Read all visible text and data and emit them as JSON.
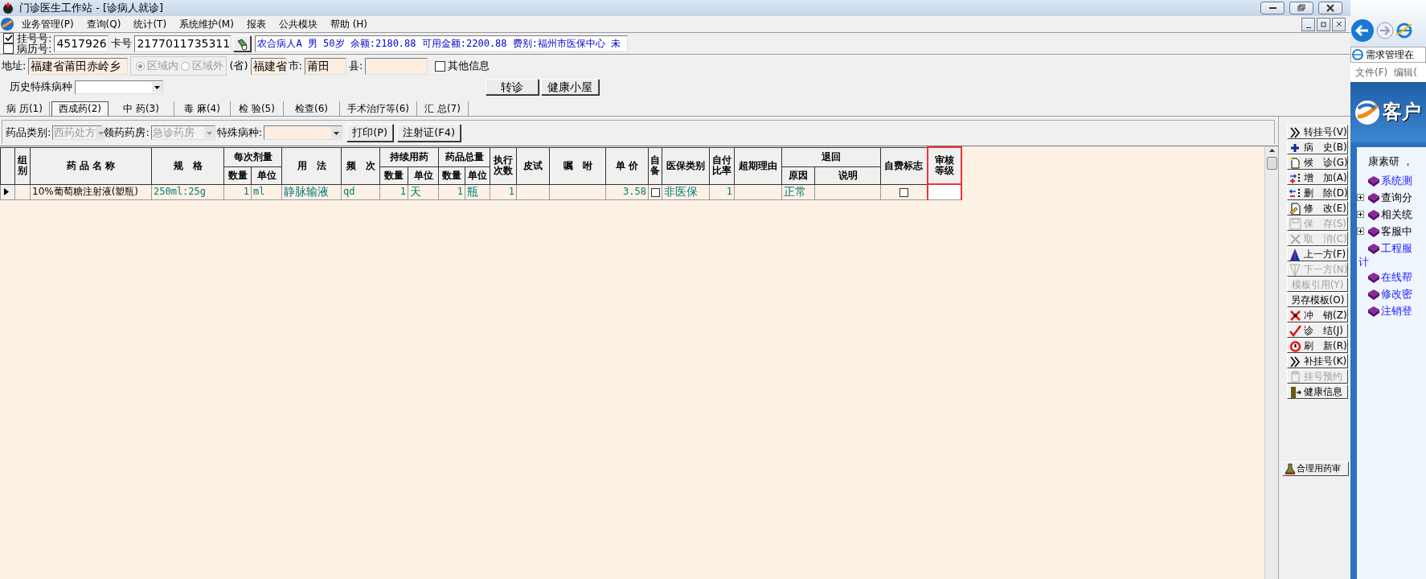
{
  "window": {
    "title": "门诊医生工作站 - [诊病人就诊]"
  },
  "menu": [
    "业务管理(P)",
    "查询(Q)",
    "统计(T)",
    "系统维护(M)",
    "报表",
    "公共模块",
    "帮助 (H)"
  ],
  "patient": {
    "id_options": [
      {
        "label": "挂号号:",
        "checked": true
      },
      {
        "label": "病历号:",
        "checked": false
      }
    ],
    "id_value": "4517926",
    "card_label": "卡号",
    "card_value": "2177011735311",
    "info": "农合病人A 男 50岁 余额:2180.88 可用金额:2200.88 费别:福州市医保中心 未"
  },
  "address": {
    "label": "地址:",
    "value": "福建省莆田赤岭乡",
    "regions": [
      {
        "label": "区域内",
        "selected": true,
        "disabled": true
      },
      {
        "label": "区域外",
        "selected": false,
        "disabled": true
      }
    ],
    "province_label": "(省)",
    "province": "福建省",
    "city_label": "市:",
    "city": "莆田",
    "county_label": "县:",
    "other_info": {
      "label": "其他信息",
      "checked": false
    }
  },
  "history": {
    "label": "历史特殊病种",
    "buttons": [
      "转诊",
      "健康小屋"
    ]
  },
  "tabs": [
    {
      "label": "病 历(1)",
      "selected": false
    },
    {
      "label": "西成药(2)",
      "selected": true
    },
    {
      "label": "中 药(3)",
      "selected": false
    },
    {
      "label": "毒 麻(4)",
      "selected": false
    },
    {
      "label": "检 验(5)",
      "selected": false
    },
    {
      "label": "检查(6)",
      "selected": false
    },
    {
      "label": "手术治疗等(6)",
      "selected": false
    },
    {
      "label": "汇 总(7)",
      "selected": false
    }
  ],
  "filters": [
    {
      "label": "药品类别:",
      "value": "西药处方",
      "disabled": true
    },
    {
      "label": "领药药房:",
      "value": "急诊药房",
      "disabled": true
    },
    {
      "label": "特殊病种:",
      "disabled": false
    }
  ],
  "filter_buttons": [
    "打印(P)",
    "注射证(F4)"
  ],
  "table": {
    "columns": [
      {
        "label": "组别",
        "highlighted": false
      },
      {
        "label": "药 品 名 称",
        "highlighted": false
      },
      {
        "label": "规　格",
        "highlighted": false
      },
      {
        "label": "每次剂量",
        "highlighted": false,
        "colspan": 2,
        "children": [
          "数量",
          "单位"
        ]
      },
      {
        "label": "用　法",
        "highlighted": false
      },
      {
        "label": "频　次",
        "highlighted": false
      },
      {
        "label": "持续用药",
        "highlighted": false,
        "colspan": 2,
        "children": [
          "数量",
          "单位"
        ]
      },
      {
        "label": "药品总量",
        "highlighted": false,
        "colspan": 2,
        "children": [
          "数量",
          "单位"
        ]
      },
      {
        "label": "执行次数",
        "highlighted": false
      },
      {
        "label": "皮试",
        "highlighted": false
      },
      {
        "label": "嘱　咐",
        "highlighted": false
      },
      {
        "label": "单 价",
        "highlighted": false
      },
      {
        "label": "自备",
        "highlighted": false
      },
      {
        "label": "医保类别",
        "highlighted": false
      },
      {
        "label": "自付比率",
        "highlighted": false
      },
      {
        "label": "超期理由",
        "highlighted": false
      },
      {
        "label": "退回",
        "highlighted": false,
        "colspan": 2,
        "children": [
          "原因",
          "说明"
        ]
      },
      {
        "label": "自费标志",
        "highlighted": false
      },
      {
        "label": "审核等级",
        "highlighted": true
      }
    ],
    "rows": [
      {
        "selected": true,
        "cells": [
          {
            "kind": "empty"
          },
          {
            "kind": "text",
            "text": "10%葡萄糖注射液(塑瓶)"
          },
          {
            "kind": "text",
            "text": "250ml:25g"
          },
          {
            "kind": "text",
            "text": "1"
          },
          {
            "kind": "text",
            "text": "ml"
          },
          {
            "kind": "text",
            "text": "静脉输液"
          },
          {
            "kind": "text",
            "text": "qd"
          },
          {
            "kind": "text",
            "text": "1"
          },
          {
            "kind": "text",
            "text": "天"
          },
          {
            "kind": "text",
            "text": "1"
          },
          {
            "kind": "text",
            "text": "瓶"
          },
          {
            "kind": "text",
            "text": "1"
          },
          {
            "kind": "empty"
          },
          {
            "kind": "empty"
          },
          {
            "kind": "text",
            "text": "3.58"
          },
          {
            "kind": "checkbox",
            "checked": false
          },
          {
            "kind": "text",
            "text": "非医保"
          },
          {
            "kind": "text",
            "text": "1"
          },
          {
            "kind": "empty"
          },
          {
            "kind": "text",
            "text": "正常"
          },
          {
            "kind": "empty"
          },
          {
            "kind": "checkbox",
            "checked": false
          },
          {
            "kind": "empty"
          }
        ]
      }
    ]
  },
  "toolbar": [
    {
      "label": "转挂号(V)",
      "disabled": false
    },
    {
      "label": "病　史(B)",
      "disabled": false
    },
    {
      "label": "候　诊(G)",
      "disabled": false
    },
    {
      "label": "增　加(A)",
      "disabled": false
    },
    {
      "label": "删　除(D)",
      "disabled": false
    },
    {
      "label": "修　改(E)",
      "disabled": false
    },
    {
      "label": "保　存(S)",
      "disabled": true
    },
    {
      "label": "取　消(C)",
      "disabled": true
    },
    {
      "label": "上一方(F)",
      "disabled": false
    },
    {
      "label": "下一方(N)",
      "disabled": true
    },
    {
      "label": "模板引用(Y)",
      "disabled": true
    },
    {
      "label": "另存模板(O)",
      "disabled": false
    },
    {
      "label": "冲　销(Z)",
      "disabled": false
    },
    {
      "label": "诊　结(J)",
      "disabled": false
    },
    {
      "label": "刷　新(R)",
      "disabled": false
    },
    {
      "label": "补挂号(K)",
      "disabled": false
    },
    {
      "label": "挂号预约",
      "disabled": true
    },
    {
      "label": "健康信息",
      "disabled": false
    }
  ],
  "review_button": "合理用药审",
  "browser": {
    "tab": "需求管理在",
    "menu": [
      "文件(F)",
      "编辑("
    ],
    "banner": "客户",
    "greeting": "康素研 ，",
    "tree": [
      {
        "kind": "link",
        "text": "系统测"
      },
      {
        "kind": "folder",
        "text": "查询分"
      },
      {
        "kind": "folder",
        "text": "相关统"
      },
      {
        "kind": "folder",
        "text": "客服中"
      },
      {
        "kind": "link",
        "text": "工程服",
        "wrap": "计"
      },
      {
        "kind": "link",
        "text": "在线帮"
      },
      {
        "kind": "link",
        "text": "修改密"
      },
      {
        "kind": "link",
        "text": "注销登"
      }
    ]
  }
}
